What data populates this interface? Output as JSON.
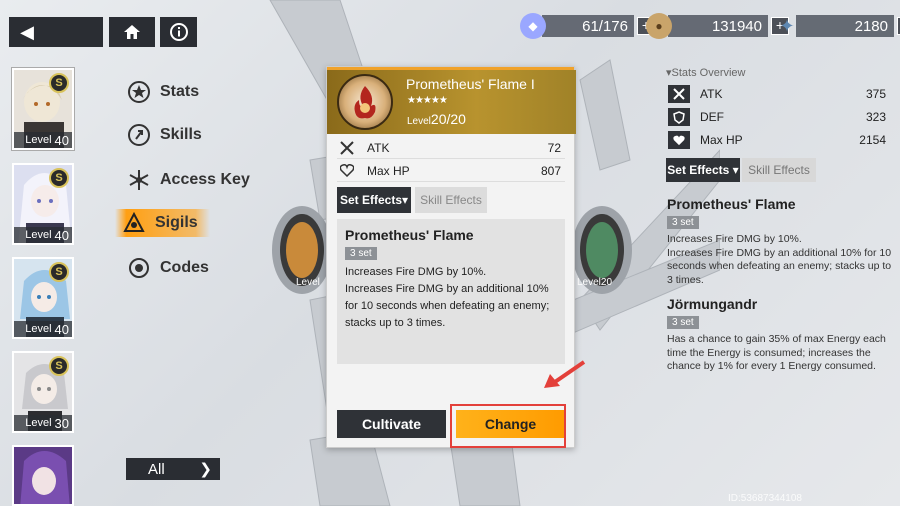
{
  "resources": [
    {
      "name": "stamina",
      "value": "61/176",
      "color": "#9aa7ff"
    },
    {
      "name": "coins",
      "value": "131940",
      "color": "#c9a46a"
    },
    {
      "name": "crystals",
      "value": "2180",
      "color": "#8fb5d8"
    }
  ],
  "characters": [
    {
      "level_label": "Level",
      "level": "40"
    },
    {
      "level_label": "Level",
      "level": "40"
    },
    {
      "level_label": "Level",
      "level": "40"
    },
    {
      "level_label": "Level",
      "level": "30"
    },
    {
      "level_label": "",
      "level": ""
    }
  ],
  "menu": {
    "stats": "Stats",
    "skills": "Skills",
    "access_key": "Access Key",
    "sigils": "Sigils",
    "codes": "Codes",
    "all": "All"
  },
  "popup": {
    "name": "Prometheus' Flame I",
    "stars": "★★★★★",
    "level_label": "Level",
    "level": "20/20",
    "stats": [
      {
        "label": "ATK",
        "value": "72",
        "icon": "atk-icon"
      },
      {
        "label": "Max HP",
        "value": "807",
        "icon": "heart-icon"
      }
    ],
    "tab_set": "Set Effects▾",
    "tab_skill": "Skill Effects",
    "effect_title": "Prometheus' Flame",
    "effect_set": "3 set",
    "effect_desc": "Increases Fire DMG by 10%.\nIncreases Fire DMG by an additional 10% for 10 seconds when defeating an enemy; stacks up to 3 times.",
    "cultivate": "Cultivate",
    "change": "Change"
  },
  "overview": {
    "title": "▾Stats Overview",
    "stats": [
      {
        "label": "ATK",
        "value": "375"
      },
      {
        "label": "DEF",
        "value": "323"
      },
      {
        "label": "Max HP",
        "value": "2154"
      }
    ],
    "tab_set": "Set Effects ▾",
    "tab_skill": "Skill Effects",
    "sets": [
      {
        "title": "Prometheus' Flame",
        "badge": "3 set",
        "desc": "Increases Fire DMG by 10%.\nIncreases Fire DMG by an additional 10% for 10 seconds when defeating an enemy; stacks up to 3 times."
      },
      {
        "title": "Jörmungandr",
        "badge": "3 set",
        "desc": "Has a chance to gain 35% of max Energy each time the Energy is consumed; increases the chance by 1% for every 1 Energy consumed."
      }
    ]
  },
  "sigil_slots": {
    "left_level": "Level",
    "right_level": "Level20"
  },
  "uid": "ID:53687344108"
}
